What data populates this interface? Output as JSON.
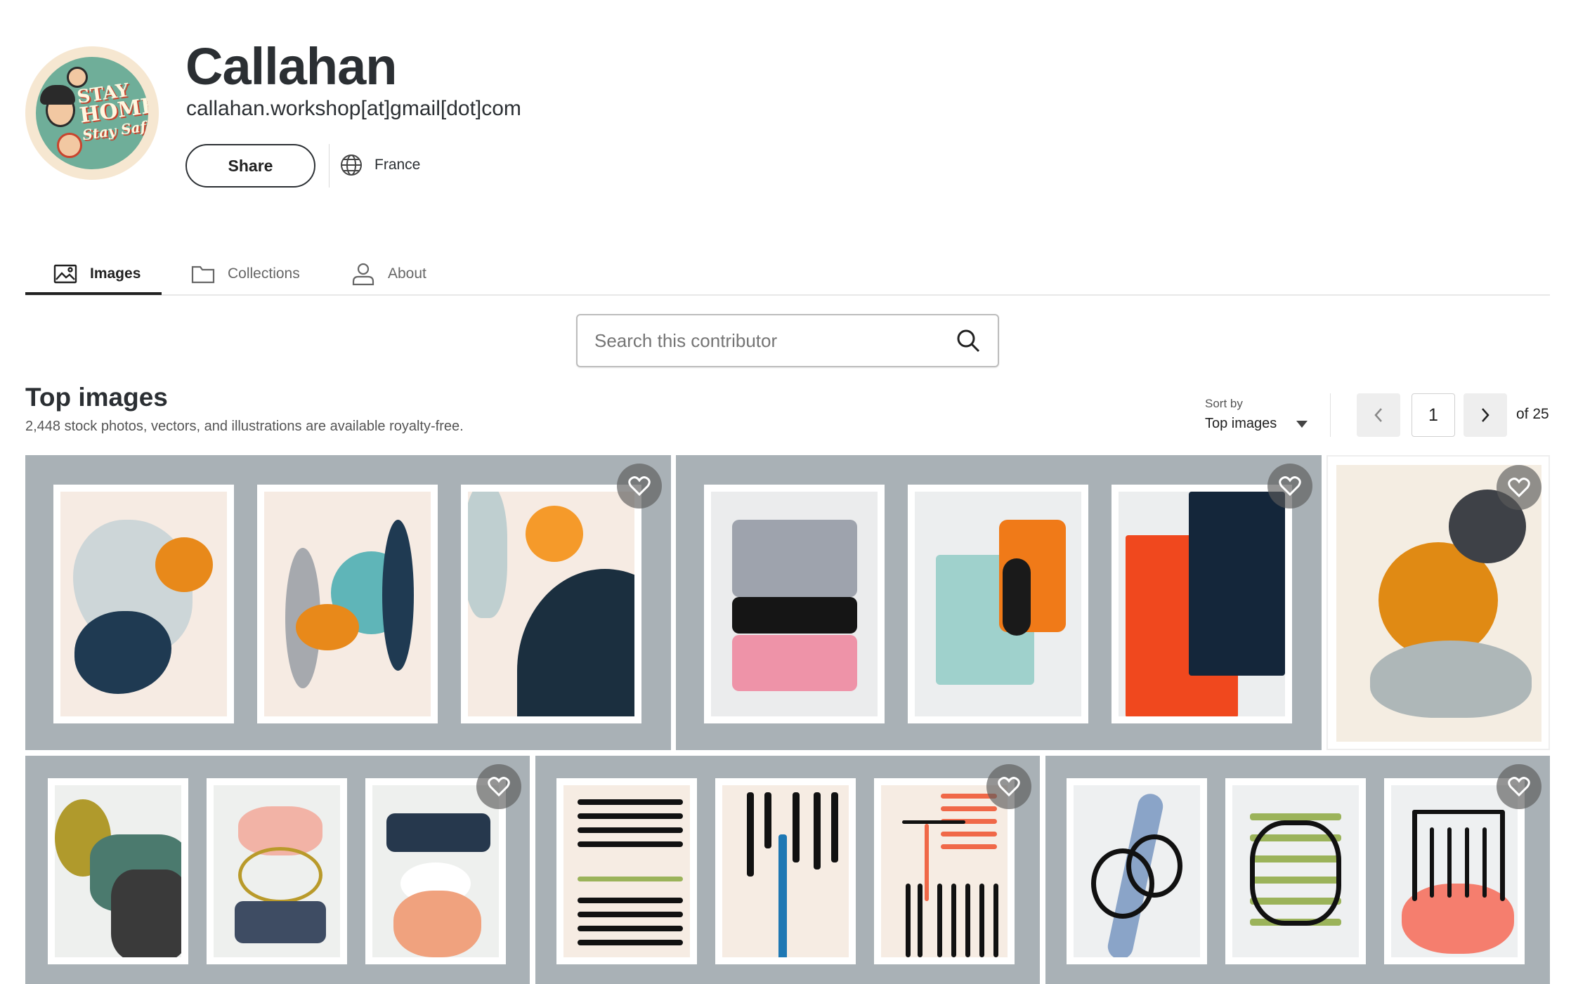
{
  "profile": {
    "name": "Callahan",
    "email": "callahan.workshop[at]gmail[dot]com",
    "share_label": "Share",
    "country": "France",
    "avatar_text": [
      "STAY",
      "HOME",
      "Stay Safe"
    ]
  },
  "tabs": [
    {
      "label": "Images",
      "icon": "image-icon",
      "active": true
    },
    {
      "label": "Collections",
      "icon": "folder-icon",
      "active": false
    },
    {
      "label": "About",
      "icon": "person-icon",
      "active": false
    }
  ],
  "search": {
    "placeholder": "Search this contributor",
    "icon": "search-icon"
  },
  "section": {
    "title": "Top images",
    "subtitle": "2,448 stock photos, vectors, and illustrations are available royalty-free."
  },
  "sort": {
    "label": "Sort by",
    "value": "Top images"
  },
  "pagination": {
    "current": "1",
    "of_label": "of 25"
  },
  "colors": {
    "tile_grey": "#a9b1b6",
    "navy": "#1f3a52",
    "orange": "#e8891a",
    "teal": "#5fb5b8",
    "red_orange": "#f0481e",
    "pink": "#ee93a8",
    "green": "#9bb35a"
  }
}
